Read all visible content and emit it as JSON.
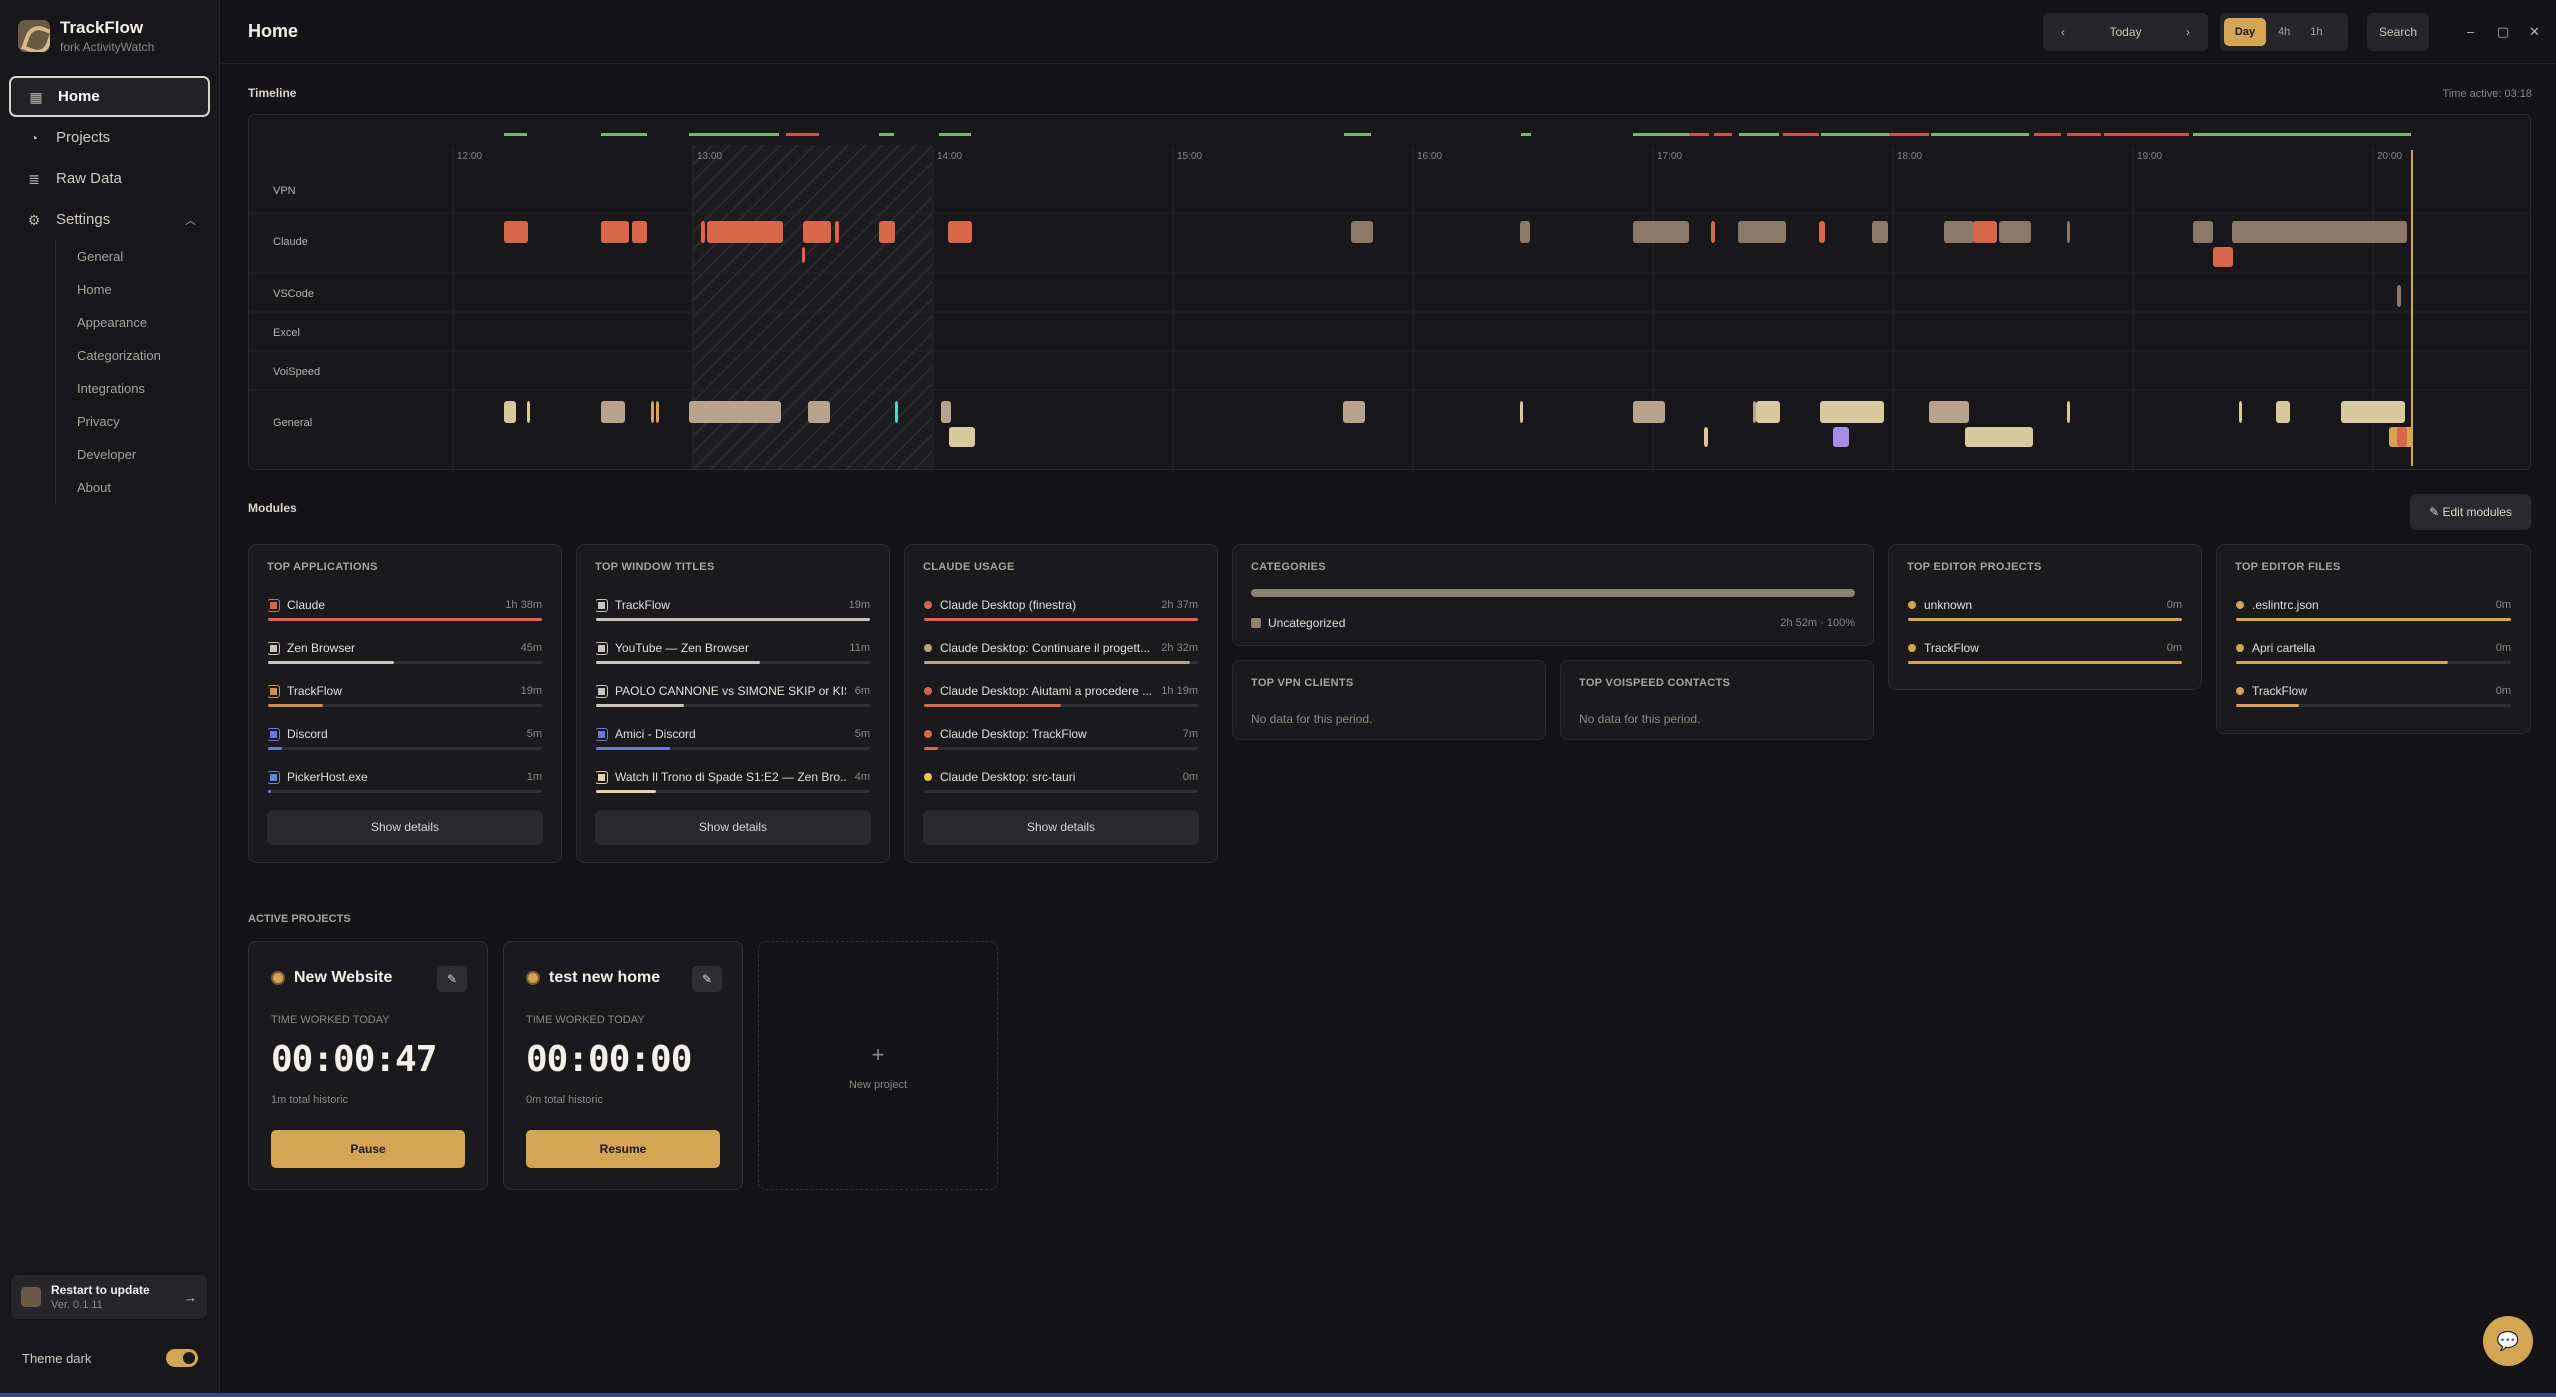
{
  "app": {
    "name": "TrackFlow",
    "subtitle": "fork ActivityWatch"
  },
  "sidebar": {
    "nav": [
      {
        "label": "Home",
        "icon": "calendar-icon"
      },
      {
        "label": "Projects",
        "icon": "stopwatch-icon"
      },
      {
        "label": "Raw Data",
        "icon": "database-icon"
      },
      {
        "label": "Settings",
        "icon": "gear-icon"
      }
    ],
    "settings_items": [
      "General",
      "Home",
      "Appearance",
      "Categorization",
      "Integrations",
      "Privacy",
      "Developer",
      "About"
    ],
    "update": {
      "title": "Restart to update",
      "version": "Ver. 0.1.11"
    },
    "theme_label": "Theme dark"
  },
  "header": {
    "title": "Home",
    "date_label": "Today",
    "prev": "‹",
    "next": "›",
    "ranges": [
      "Day",
      "4h",
      "1h"
    ],
    "search": "Search",
    "window_controls": [
      "–",
      "▢",
      "✕"
    ]
  },
  "timeline": {
    "title": "Timeline",
    "time_active": "Time active: 03:18",
    "hours": [
      "12:00",
      "13:00",
      "14:00",
      "15:00",
      "16:00",
      "17:00",
      "18:00",
      "19:00",
      "20:00"
    ],
    "rows": [
      "VPN",
      "Claude",
      "VSCode",
      "Excel",
      "VoiSpeed",
      "General"
    ]
  },
  "modules": {
    "title": "Modules",
    "edit_label": "✎ Edit modules",
    "show_details": "Show details",
    "top_applications": {
      "title": "TOP APPLICATIONS",
      "items": [
        {
          "label": "Claude",
          "value": "1h 38m",
          "fill": 1.0,
          "color": "#d9674a",
          "icon": "claude-app-icon"
        },
        {
          "label": "Zen Browser",
          "value": "45m",
          "fill": 0.46,
          "color": "#c8c4bc",
          "icon": "zen-app-icon"
        },
        {
          "label": "TrackFlow",
          "value": "19m",
          "fill": 0.2,
          "color": "#c8905a",
          "icon": "trackflow-app-icon"
        },
        {
          "label": "Discord",
          "value": "5m",
          "fill": 0.05,
          "color": "#6c74e8",
          "icon": "discord-app-icon"
        },
        {
          "label": "PickerHost.exe",
          "value": "1m",
          "fill": 0.01,
          "color": "#5a8ad8",
          "icon": "picker-app-icon"
        }
      ]
    },
    "top_window_titles": {
      "title": "TOP WINDOW TITLES",
      "items": [
        {
          "label": "TrackFlow",
          "value": "19m",
          "fill": 1.0,
          "color": "#c8c4bc",
          "icon": "trackflow-app-icon"
        },
        {
          "label": "YouTube — Zen Browser",
          "value": "11m",
          "fill": 0.6,
          "color": "#c8c4bc",
          "icon": "zen-app-icon"
        },
        {
          "label": "PAOLO CANNONE vs SIMONE SKIP or KIS...",
          "value": "6m",
          "fill": 0.32,
          "color": "#c8c4bc",
          "icon": "zen-app-icon"
        },
        {
          "label": "Amici - Discord",
          "value": "5m",
          "fill": 0.27,
          "color": "#6c74e8",
          "icon": "discord-app-icon"
        },
        {
          "label": "Watch Il Trono di Spade S1:E2 — Zen Bro...",
          "value": "4m",
          "fill": 0.22,
          "color": "#e0d6a8",
          "icon": "zen-app-icon"
        }
      ]
    },
    "claude_usage": {
      "title": "CLAUDE USAGE",
      "items": [
        {
          "label": "Claude Desktop (finestra)",
          "value": "2h 37m",
          "fill": 1.0,
          "color": "#d9674a"
        },
        {
          "label": "Claude Desktop: Continuare il progett...",
          "value": "2h 32m",
          "fill": 0.97,
          "color": "#b8a48c"
        },
        {
          "label": "Claude Desktop: Aiutami a procedere ...",
          "value": "1h 19m",
          "fill": 0.5,
          "color": "#d9674a"
        },
        {
          "label": "Claude Desktop: TrackFlow",
          "value": "7m",
          "fill": 0.05,
          "color": "#d9674a"
        },
        {
          "label": "Claude Desktop: src-tauri",
          "value": "0m",
          "fill": 0.0,
          "color": "#e8c84a"
        }
      ]
    },
    "categories": {
      "title": "CATEGORIES",
      "items": [
        {
          "label": "Uncategorized",
          "value": "2h 52m · 100%",
          "fill": 1.0,
          "color": "#8c8070"
        }
      ]
    },
    "top_vpn_clients": {
      "title": "TOP VPN CLIENTS",
      "empty": "No data for this period."
    },
    "top_voispeed_contacts": {
      "title": "TOP VOISPEED CONTACTS",
      "empty": "No data for this period."
    },
    "top_editor_projects": {
      "title": "TOP EDITOR PROJECTS",
      "items": [
        {
          "label": "unknown",
          "value": "0m",
          "fill": 1.0,
          "color": "#d4a552"
        },
        {
          "label": "TrackFlow",
          "value": "0m",
          "fill": 1.0,
          "color": "#d4a552"
        }
      ]
    },
    "top_editor_files": {
      "title": "TOP EDITOR FILES",
      "items": [
        {
          "label": ".eslintrc.json",
          "value": "0m",
          "fill": 1.0,
          "color": "#d4a552"
        },
        {
          "label": "Apri cartella",
          "value": "0m",
          "fill": 0.77,
          "color": "#d4a552"
        },
        {
          "label": "TrackFlow",
          "value": "0m",
          "fill": 0.23,
          "color": "#d4a552"
        }
      ]
    }
  },
  "projects": {
    "title": "ACTIVE PROJECTS",
    "time_label": "TIME WORKED TODAY",
    "items": [
      {
        "name": "New Website",
        "time": "00:00:47",
        "historic": "1m total historic",
        "action": "Pause"
      },
      {
        "name": "test new home",
        "time": "00:00:00",
        "historic": "0m total historic",
        "action": "Resume"
      }
    ],
    "new_label": "New project",
    "new_plus": "+",
    "edit_icon": "✎"
  },
  "colors": {
    "accent": "#d4a552",
    "claude": "#d9674a",
    "general": "#c8b28c"
  }
}
